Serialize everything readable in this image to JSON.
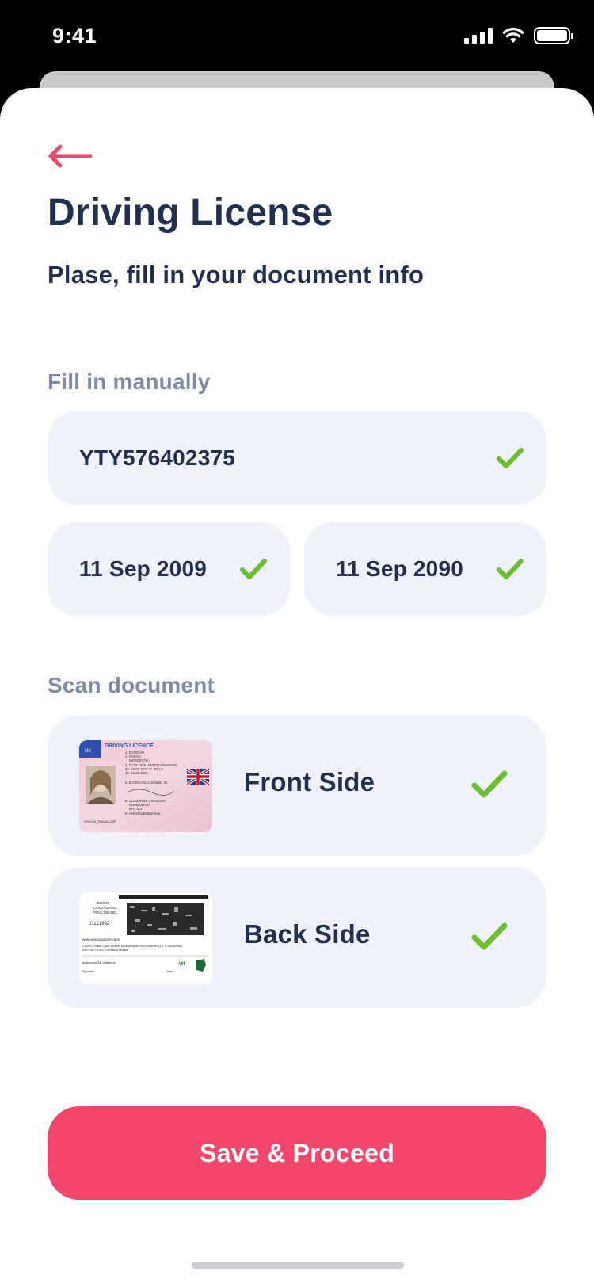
{
  "status_bar": {
    "time": "9:41"
  },
  "header": {
    "title": "Driving License",
    "subtitle": "Plase, fill in your document info"
  },
  "manual": {
    "label": "Fill in manually",
    "license_number": "YTY576402375",
    "issue_date": "11 Sep 2009",
    "expiry_date": "11 Sep 2090"
  },
  "scan": {
    "label": "Scan document",
    "front_label": "Front Side",
    "back_label": "Back Side",
    "front_thumb": {
      "heading": "DRIVING LICENCE",
      "country": "UK",
      "lines": [
        "1. MORGAN",
        "2. SARAH",
        "MEREDYTH",
        "3. 11.03.1976 UNITED KINGDOM",
        "4a. 19.01.2013 4c. DVLA",
        "4b. 18.01.2023",
        "5. MORGA753116SM9IJ 35",
        "8. 122 BURNS CRESCENT",
        "EDINBURGH",
        "EH1 9GP",
        "9. AM/A/B1/B/f/k/l/n/p/q"
      ],
      "footer": "DVLA   INTERNAL USE"
    },
    "back_thumb": {
      "lines": [
        "$090.00",
        "CO00-019-001",
        "PR01 D08 BEL",
        "01121992",
        "www.wisconsindmv.gov",
        "CLASS: Online-Cycle Vehicle, M-Motorcycle  ENDORSEMENTS: S-School Bus",
        "RESTRICTIONS: Corrective Lenses",
        "Anatomical Gift Statement",
        "Signature",
        "Date"
      ],
      "state_mark": "-WI-"
    }
  },
  "actions": {
    "primary": "Save & Proceed"
  },
  "colors": {
    "accent": "#f3466b",
    "text": "#22304f",
    "muted": "#7f8aa3",
    "field_bg": "#eff2fa",
    "check": "#6cbd2f"
  },
  "icons": [
    "back-arrow-icon",
    "check-icon",
    "signal-icon",
    "wifi-icon",
    "battery-icon"
  ]
}
